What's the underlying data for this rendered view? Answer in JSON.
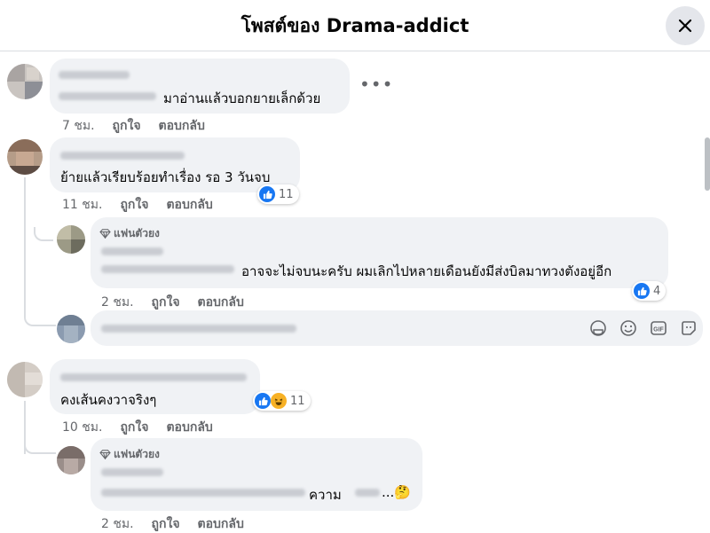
{
  "header": {
    "title": "โพสต์ของ Drama-addict"
  },
  "comments": [
    {
      "text": "มาอ่านแล้วบอกยายเล็กด้วย",
      "time": "7 ชม.",
      "like_label": "ถูกใจ",
      "reply_label": "ตอบกลับ"
    },
    {
      "text": "ย้ายแล้วเรียบร้อยทำเรื่อง รอ 3 วันจบ",
      "time": "11 ชม.",
      "like_label": "ถูกใจ",
      "reply_label": "ตอบกลับ",
      "reaction_count": "11"
    },
    {
      "badge": "แฟนตัวยง",
      "text": "อาจจะไม่จบนะครับ ผมเลิกไปหลายเดือนยังมีส่งบิลมาทวงตังอยู่อีก",
      "time": "2 ชม.",
      "like_label": "ถูกใจ",
      "reply_label": "ตอบกลับ",
      "reaction_count": "4"
    },
    {
      "text": "คงเส้นคงวาจริงๆ",
      "time": "10 ชม.",
      "like_label": "ถูกใจ",
      "reply_label": "ตอบกลับ",
      "reaction_count": "11"
    },
    {
      "badge": "แฟนตัวยง",
      "text": "ความ",
      "text_end": "...🤔",
      "time": "2 ชม.",
      "like_label": "ถูกใจ",
      "reply_label": "ตอบกลับ"
    }
  ],
  "reply_box": {
    "icons": [
      "sticker-icon",
      "emoji-icon",
      "gif-icon",
      "avatar-sticker-icon"
    ]
  },
  "colors": {
    "like_blue": "#1877f2",
    "bubble_bg": "#f0f2f5",
    "meta_gray": "#65676b",
    "badge_orange": "#e07a00"
  }
}
